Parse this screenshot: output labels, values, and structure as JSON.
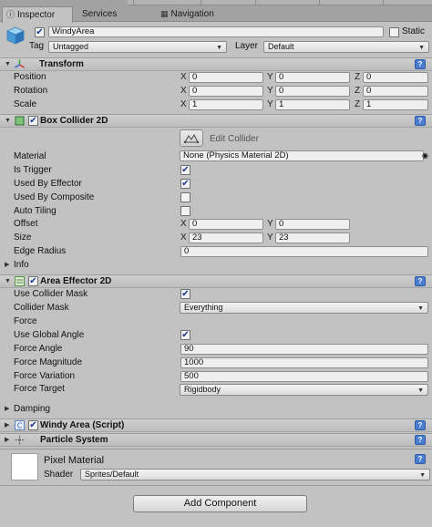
{
  "tabs": [
    {
      "label": "Inspector",
      "icon": "inspector-icon",
      "active": true
    },
    {
      "label": "Services",
      "icon": "",
      "active": false
    },
    {
      "label": "Navigation",
      "icon": "navigation-icon",
      "active": false
    }
  ],
  "header": {
    "object_name": "WindyArea",
    "active": true,
    "static_label": "Static",
    "tag_label": "Tag",
    "tag_value": "Untagged",
    "layer_label": "Layer",
    "layer_value": "Default"
  },
  "transform": {
    "title": "Transform",
    "rows": [
      {
        "label": "Position",
        "x": "0",
        "y": "0",
        "z": "0"
      },
      {
        "label": "Rotation",
        "x": "0",
        "y": "0",
        "z": "0"
      },
      {
        "label": "Scale",
        "x": "1",
        "y": "1",
        "z": "1"
      }
    ]
  },
  "box_collider": {
    "title": "Box Collider 2D",
    "enabled": true,
    "edit_collider_label": "Edit Collider",
    "material_label": "Material",
    "material_value": "None (Physics Material 2D)",
    "is_trigger_label": "Is Trigger",
    "is_trigger": true,
    "used_by_effector_label": "Used By Effector",
    "used_by_effector": true,
    "used_by_composite_label": "Used By Composite",
    "used_by_composite": false,
    "auto_tiling_label": "Auto Tiling",
    "auto_tiling": false,
    "offset_label": "Offset",
    "offset_x": "0",
    "offset_y": "0",
    "size_label": "Size",
    "size_x": "23",
    "size_y": "23",
    "edge_radius_label": "Edge Radius",
    "edge_radius": "0",
    "info_label": "Info"
  },
  "area_effector": {
    "title": "Area Effector 2D",
    "enabled": true,
    "use_collider_mask_label": "Use Collider Mask",
    "use_collider_mask": true,
    "collider_mask_label": "Collider Mask",
    "collider_mask_value": "Everything",
    "force_label": "Force",
    "use_global_angle_label": "Use Global Angle",
    "use_global_angle": true,
    "force_angle_label": "Force Angle",
    "force_angle": "90",
    "force_magnitude_label": "Force Magnitude",
    "force_magnitude": "1000",
    "force_variation_label": "Force Variation",
    "force_variation": "500",
    "force_target_label": "Force Target",
    "force_target_value": "Rigidbody",
    "damping_label": "Damping"
  },
  "windy_area": {
    "title": "Windy Area (Script)"
  },
  "particle_system": {
    "title": "Particle System"
  },
  "pixel_material": {
    "title": "Pixel Material",
    "shader_label": "Shader",
    "shader_value": "Sprites/Default"
  },
  "add_component_label": "Add Component",
  "help_glyph": "?",
  "gear_glyph": "⚙",
  "check_glyph": "✔",
  "x_label": "X",
  "y_label": "Y",
  "z_label": "Z",
  "colors": {
    "help_blue": "#4a7dcf",
    "panel_bg": "#c2c2c2"
  }
}
